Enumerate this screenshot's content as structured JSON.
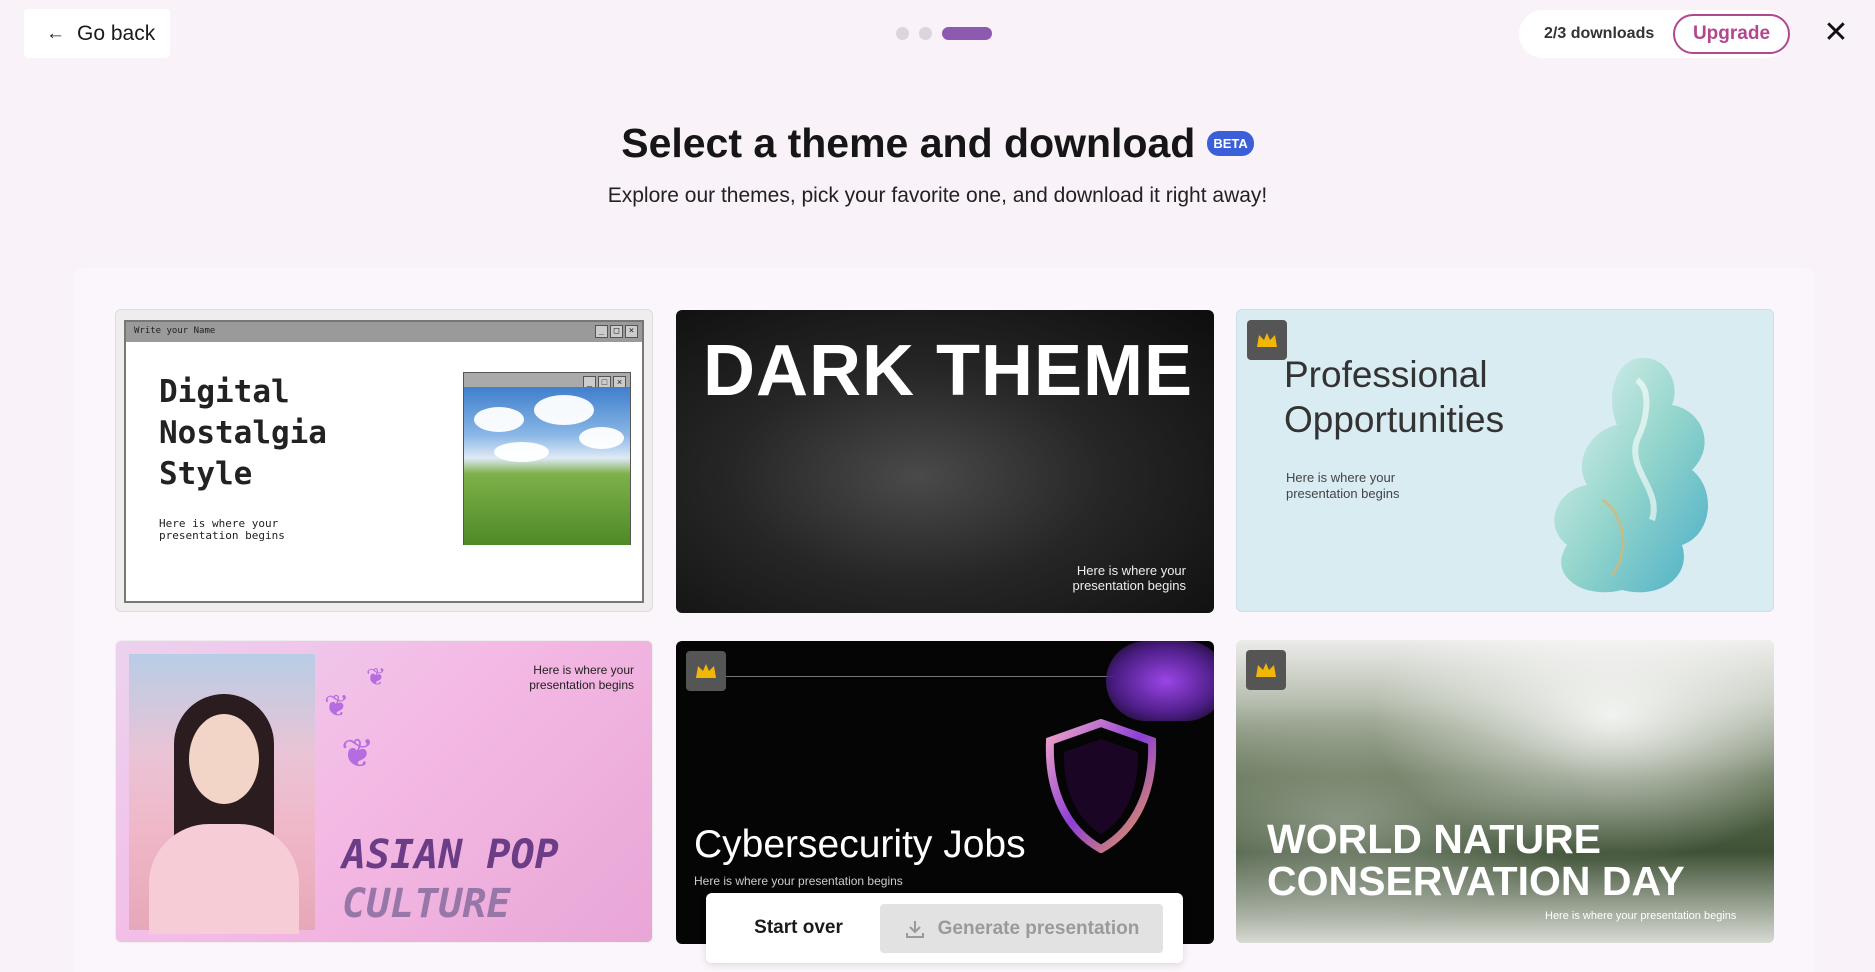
{
  "header": {
    "go_back_label": "Go back",
    "downloads": "2/3 downloads",
    "upgrade_label": "Upgrade",
    "close_symbol": "✕"
  },
  "steps": {
    "current": 3,
    "total": 3
  },
  "page": {
    "title": "Select a theme and download",
    "badge": "BETA",
    "subtitle": "Explore our themes, pick your favorite one, and download it right away!"
  },
  "themes": [
    {
      "window_title": "Write your Name",
      "title_lines": [
        "Digital",
        "Nostalgia",
        "Style"
      ],
      "subtitle_lines": [
        "Here is where your",
        "presentation begins"
      ],
      "premium": false
    },
    {
      "title": "DARK THEME",
      "subtitle_lines": [
        "Here is where your",
        "presentation begins"
      ],
      "premium": false
    },
    {
      "title_lines": [
        "Professional",
        "Opportunities"
      ],
      "subtitle_lines": [
        "Here is where your",
        "presentation begins"
      ],
      "premium": true
    },
    {
      "title_lines": [
        "ASIAN POP",
        "CULTURE"
      ],
      "subtitle_lines": [
        "Here is where your",
        "presentation begins"
      ],
      "premium": false
    },
    {
      "title": "Cybersecurity Jobs",
      "subtitle": "Here is where your presentation begins",
      "premium": true
    },
    {
      "title_lines": [
        "WORLD NATURE",
        "CONSERVATION DAY"
      ],
      "subtitle": "Here is where your presentation begins",
      "premium": true
    }
  ],
  "actions": {
    "start_over_label": "Start over",
    "generate_label": "Generate presentation"
  },
  "colors": {
    "accent": "#8e5ab0",
    "upgrade": "#b1478f",
    "badge": "#3b5ed9",
    "crown": "#f2b705"
  },
  "icons": [
    "arrow-left-icon",
    "close-icon",
    "crown-icon",
    "download-icon"
  ]
}
